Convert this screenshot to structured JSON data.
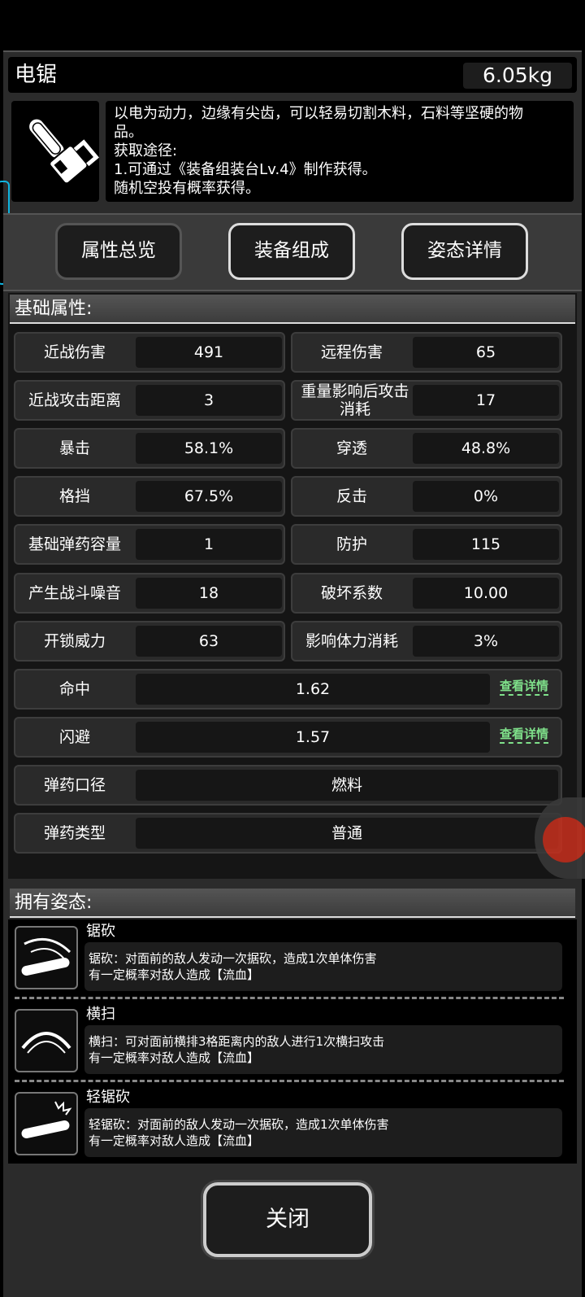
{
  "item": {
    "name": "电锯",
    "weight": "6.05kg",
    "icon": "chainsaw-icon",
    "description": [
      "以电为动力，边缘有尖齿，可以轻易切割木料，石料等坚硬的物",
      "品。",
      "获取途径:",
      "1.可通过《装备组装台Lv.4》制作获得。",
      "随机空投有概率获得。"
    ]
  },
  "tabs": [
    "属性总览",
    "装备组成",
    "姿态详情"
  ],
  "stats": {
    "header": "基础属性:",
    "rows": [
      [
        {
          "label": "近战伤害",
          "value": "491"
        },
        {
          "label": "远程伤害",
          "value": "65"
        }
      ],
      [
        {
          "label": "近战攻击距离",
          "value": "3"
        },
        {
          "label": "重量影响后攻击消耗",
          "value": "17"
        }
      ],
      [
        {
          "label": "暴击",
          "value": "58.1%"
        },
        {
          "label": "穿透",
          "value": "48.8%"
        }
      ],
      [
        {
          "label": "格挡",
          "value": "67.5%"
        },
        {
          "label": "反击",
          "value": "0%"
        }
      ],
      [
        {
          "label": "基础弹药容量",
          "value": "1"
        },
        {
          "label": "防护",
          "value": "115"
        }
      ],
      [
        {
          "label": "产生战斗噪音",
          "value": "18"
        },
        {
          "label": "破坏系数",
          "value": "10.00"
        }
      ],
      [
        {
          "label": "开锁威力",
          "value": "63"
        },
        {
          "label": "影响体力消耗",
          "value": "3%"
        }
      ]
    ],
    "wide": [
      {
        "label": "命中",
        "value": "1.62",
        "link": "查看详情"
      },
      {
        "label": "闪避",
        "value": "1.57",
        "link": "查看详情"
      },
      {
        "label": "弹药口径",
        "value": "燃料"
      },
      {
        "label": "弹药类型",
        "value": "普通"
      }
    ]
  },
  "poses": {
    "header": "拥有姿态:",
    "items": [
      {
        "name": "锯砍",
        "icon": "saw-chop-icon",
        "desc1": "锯砍：对面前的敌人发动一次据砍，造成1次单体伤害",
        "desc2": "有一定概率对敌人造成【流血】"
      },
      {
        "name": "横扫",
        "icon": "sweep-icon",
        "desc1": "横扫：可对面前横排3格距离内的敌人进行1次横扫攻击",
        "desc2": "有一定概率对敌人造成【流血】"
      },
      {
        "name": "轻锯砍",
        "icon": "light-saw-chop-icon",
        "desc1": "轻锯砍：对面前的敌人发动一次据砍，造成1次单体伤害",
        "desc2": "有一定概率对敌人造成【流血】"
      }
    ]
  },
  "close_label": "关闭",
  "colors": {
    "link": "#7fe08a",
    "edge_tab": "#0fb4e0"
  }
}
